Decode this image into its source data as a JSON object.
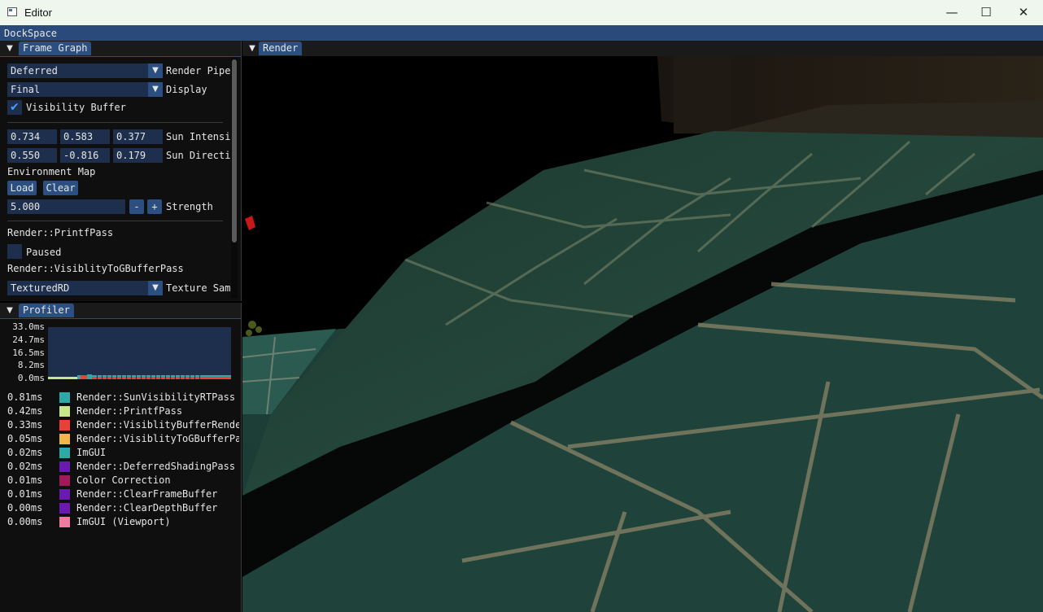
{
  "window": {
    "title": "Editor",
    "minimize_icon": "minimize-icon",
    "maximize_icon": "maximize-icon",
    "close_icon": "close-icon",
    "minimize_glyph": "—",
    "maximize_glyph": "☐",
    "close_glyph": "✕"
  },
  "dockspace": {
    "label": "DockSpace"
  },
  "frame_graph": {
    "tab": "Frame Graph",
    "collapse_glyph": "▼",
    "combo_glyph": "▼",
    "render_pipeline": {
      "value": "Deferred",
      "label": "Render Pipe"
    },
    "display": {
      "value": "Final",
      "label": "Display"
    },
    "visibility_buffer": {
      "label": "Visibility Buffer",
      "checked": true,
      "check_glyph": "✔"
    },
    "sun_intensity": {
      "values": [
        "0.734",
        "0.583",
        "0.377"
      ],
      "label": "Sun Intensi"
    },
    "sun_direction": {
      "values": [
        "0.550",
        "-0.816",
        "0.179"
      ],
      "label": "Sun Directi"
    },
    "environment_map": {
      "label": "Environment Map",
      "load_label": "Load",
      "clear_label": "Clear",
      "strength_value": "5.000",
      "minus_label": "-",
      "plus_label": "+",
      "strength_label": "Strength"
    },
    "printf_pass": {
      "header": "Render::PrintfPass",
      "paused_label": "Paused",
      "paused": false
    },
    "vis_to_gbuffer": {
      "header": "Render::VisiblityToGBufferPass",
      "texture_value": "TexturedRD",
      "texture_label": "Texture Sam"
    }
  },
  "profiler": {
    "tab": "Profiler",
    "collapse_glyph": "▼",
    "y_ticks": [
      "33.0ms",
      "24.7ms",
      "16.5ms",
      "8.2ms",
      "0.0ms"
    ],
    "rows": [
      {
        "time": "0.81ms",
        "name": "Render::SunVisibilityRTPass",
        "color": "#2ea8a8"
      },
      {
        "time": "0.42ms",
        "name": "Render::PrintfPass",
        "color": "#c8e68a"
      },
      {
        "time": "0.33ms",
        "name": "Render::VisiblityBufferRende",
        "color": "#e8413a"
      },
      {
        "time": "0.05ms",
        "name": "Render::VisiblityToGBufferPa",
        "color": "#f2b547"
      },
      {
        "time": "0.02ms",
        "name": "ImGUI",
        "color": "#2ea8a8"
      },
      {
        "time": "0.02ms",
        "name": "Render::DeferredShadingPass",
        "color": "#6a1ab0"
      },
      {
        "time": "0.01ms",
        "name": "Color Correction",
        "color": "#a01a5a"
      },
      {
        "time": "0.01ms",
        "name": "Render::ClearFrameBuffer",
        "color": "#6a1ab0"
      },
      {
        "time": "0.00ms",
        "name": "Render::ClearDepthBuffer",
        "color": "#6a1ab0"
      },
      {
        "time": "0.00ms",
        "name": "ImGUI (Viewport)",
        "color": "#f07aa0"
      }
    ]
  },
  "render": {
    "tab": "Render",
    "collapse_glyph": "▼"
  },
  "colors": {
    "accent": "#2b4f80",
    "frame_bg": "#1d2f4c",
    "title_bar": "#294a7a"
  }
}
